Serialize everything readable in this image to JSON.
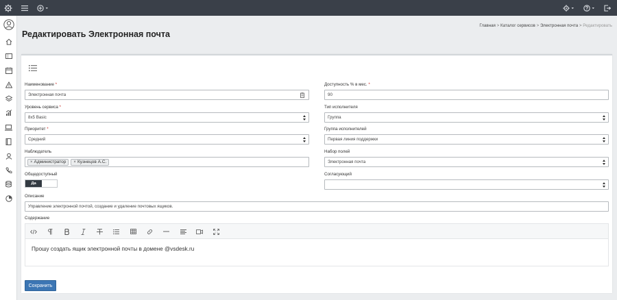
{
  "header": {
    "title": "Редактировать Электронная почта",
    "breadcrumb": [
      {
        "label": "Главная"
      },
      {
        "label": "Каталог сервисов"
      },
      {
        "label": "Электронная почта"
      },
      {
        "label": "Редактировать"
      }
    ],
    "breadcrumb_separator": ">"
  },
  "form": {
    "name": {
      "label": "Наименование",
      "required": "*",
      "value": "Электронная почта"
    },
    "availability": {
      "label": "Доступность % в мес.",
      "required": "*",
      "value": "90"
    },
    "service_level": {
      "label": "Уровень сервиса",
      "required": "*",
      "value": "8x5 Basic"
    },
    "executor_type": {
      "label": "Тип исполнителя",
      "value": "Группа"
    },
    "priority": {
      "label": "Приоритет",
      "required": "*",
      "value": "Средний"
    },
    "executor_group": {
      "label": "Группа исполнителей",
      "value": "Первая линия поддержки"
    },
    "observer": {
      "label": "Наблюдатель",
      "tags": [
        "Администратор",
        "Кузнецов А.С."
      ],
      "remove_glyph": "×"
    },
    "field_set": {
      "label": "Набор полей",
      "value": "Электронная почта"
    },
    "public": {
      "label": "Общедоступный",
      "toggle_on_label": "Да"
    },
    "approver": {
      "label": "Согласующий",
      "value": ""
    },
    "description": {
      "label": "Описание",
      "value": "Управление электронной почтой, создание и удаление почтовых ящиков."
    },
    "content": {
      "label": "Содержание",
      "text": "Прошу создать ящик электронной почты в домене @vsdesk.ru"
    },
    "save_label": "Сохранить"
  },
  "editor_toolbar": [
    "code-view-icon",
    "paragraph-icon",
    "bold-icon",
    "italic-icon",
    "strikethrough-icon",
    "list-icon",
    "table-icon",
    "link-icon",
    "horizontal-rule-icon",
    "align-icon",
    "video-icon",
    "fullscreen-icon"
  ],
  "colors": {
    "topbar": "#3a4049",
    "primary_button": "#3c76b4",
    "required_marker": "#c9302c",
    "toggle_on": "#333a42"
  }
}
